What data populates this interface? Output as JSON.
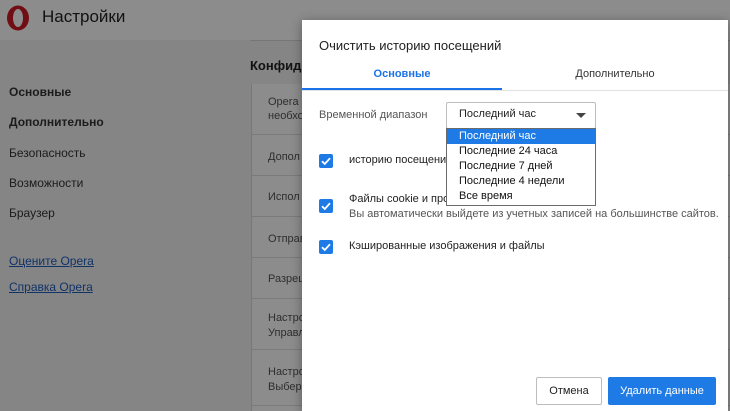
{
  "app": {
    "title": "Настройки",
    "logo": "opera-logo-icon"
  },
  "sidebar": {
    "items": [
      {
        "label": "Основные",
        "active": true
      },
      {
        "label": "Дополнительно",
        "active": true
      },
      {
        "label": "Безопасность",
        "active": false
      },
      {
        "label": "Возможности",
        "active": false
      },
      {
        "label": "Браузер",
        "active": false
      }
    ],
    "links": [
      "Оцените Opera",
      "Справка Opera"
    ]
  },
  "content": {
    "section_title": "Конфиде",
    "rows": [
      {
        "text": "Opera",
        "sub": "необхо"
      },
      {
        "text": "Допол",
        "sub": ""
      },
      {
        "text": "Испол",
        "sub": ""
      },
      {
        "text": "Отправ",
        "sub": ""
      },
      {
        "text": "Разреш",
        "sub": ""
      },
      {
        "text": "Настро",
        "sub": "Управл"
      },
      {
        "text": "Настро",
        "sub": "Выбер"
      }
    ]
  },
  "dialog": {
    "title": "Очистить историю посещений",
    "tabs": [
      {
        "label": "Основные",
        "active": true
      },
      {
        "label": "Дополнительно",
        "active": false
      }
    ],
    "time_range": {
      "label": "Временной диапазон",
      "selected": "Последний час",
      "options": [
        "Последний час",
        "Последние 24 часа",
        "Последние 7 дней",
        "Последние 4 недели",
        "Все время"
      ]
    },
    "checkboxes": [
      {
        "label": "историю посещени",
        "sub": "",
        "checked": true
      },
      {
        "label": "Файлы cookie и про",
        "sub": "Вы автоматически выйдете из учетных записей на большинстве сайтов.",
        "checked": true
      },
      {
        "label": "Кэшированные изображения и файлы",
        "sub": "",
        "checked": true
      }
    ],
    "buttons": {
      "cancel": "Отмена",
      "delete": "Удалить данные"
    }
  },
  "colors": {
    "accent": "#1e7be6",
    "logo": "#cc1b23"
  }
}
